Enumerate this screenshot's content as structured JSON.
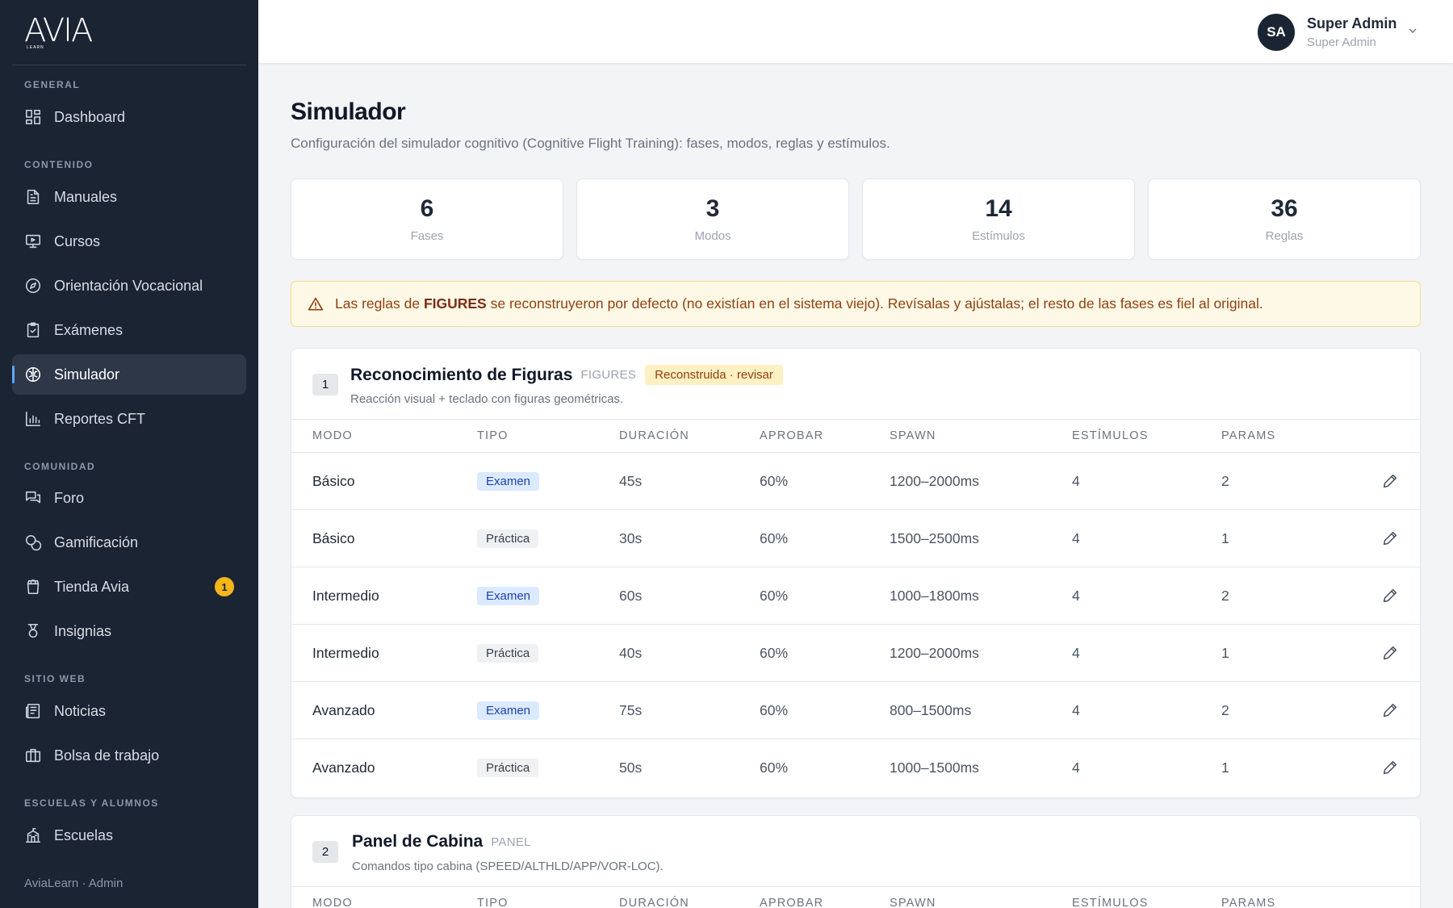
{
  "brand": {
    "logo": "AVIA",
    "logo_sub": "LEARN"
  },
  "sidebar": {
    "sections": [
      {
        "title": "GENERAL"
      },
      {
        "title": "CONTENIDO"
      },
      {
        "title": "COMUNIDAD"
      },
      {
        "title": "SITIO WEB"
      },
      {
        "title": "ESCUELAS Y ALUMNOS"
      }
    ],
    "items": [
      {
        "label": "Dashboard",
        "icon": "dashboard-icon"
      },
      {
        "label": "Manuales",
        "icon": "document-icon"
      },
      {
        "label": "Cursos",
        "icon": "presentation-icon"
      },
      {
        "label": "Orientación Vocacional",
        "icon": "compass-icon"
      },
      {
        "label": "Exámenes",
        "icon": "clipboard-check-icon"
      },
      {
        "label": "Simulador",
        "icon": "brain-icon",
        "active": true
      },
      {
        "label": "Reportes CFT",
        "icon": "bar-chart-icon"
      },
      {
        "label": "Foro",
        "icon": "chat-icon"
      },
      {
        "label": "Gamificación",
        "icon": "coins-icon"
      },
      {
        "label": "Tienda Avia",
        "icon": "shopping-bag-icon",
        "badge": "1"
      },
      {
        "label": "Insignias",
        "icon": "medal-icon"
      },
      {
        "label": "Noticias",
        "icon": "newspaper-icon"
      },
      {
        "label": "Bolsa de trabajo",
        "icon": "briefcase-icon"
      },
      {
        "label": "Escuelas",
        "icon": "school-icon"
      }
    ],
    "footer": "AviaLearn · Admin"
  },
  "user": {
    "initials": "SA",
    "name": "Super Admin",
    "role": "Super Admin"
  },
  "page": {
    "title": "Simulador",
    "subtitle": "Configuración del simulador cognitivo (Cognitive Flight Training): fases, modos, reglas y estímulos."
  },
  "stats": [
    {
      "value": "6",
      "label": "Fases"
    },
    {
      "value": "3",
      "label": "Modos"
    },
    {
      "value": "14",
      "label": "Estímulos"
    },
    {
      "value": "36",
      "label": "Reglas"
    }
  ],
  "alert": {
    "prefix": "Las reglas de ",
    "bold": "FIGURES",
    "suffix": " se reconstruyeron por defecto (no existían en el sistema viejo). Revísalas y ajústalas; el resto de las fases es fiel al original."
  },
  "table_headers": {
    "modo": "MODO",
    "tipo": "TIPO",
    "duracion": "DURACIÓN",
    "aprobar": "APROBAR",
    "spawn": "SPAWN",
    "estimulos": "ESTÍMULOS",
    "params": "PARAMS"
  },
  "phases": [
    {
      "number": "1",
      "title": "Reconocimiento de Figuras",
      "code": "FIGURES",
      "badge": "Reconstruida · revisar",
      "description": "Reacción visual + teclado con figuras geométricas.",
      "rows": [
        {
          "modo": "Básico",
          "tipo": "Examen",
          "duracion": "45s",
          "aprobar": "60%",
          "spawn": "1200–2000ms",
          "estimulos": "4",
          "params": "2"
        },
        {
          "modo": "Básico",
          "tipo": "Práctica",
          "duracion": "30s",
          "aprobar": "60%",
          "spawn": "1500–2500ms",
          "estimulos": "4",
          "params": "1"
        },
        {
          "modo": "Intermedio",
          "tipo": "Examen",
          "duracion": "60s",
          "aprobar": "60%",
          "spawn": "1000–1800ms",
          "estimulos": "4",
          "params": "2"
        },
        {
          "modo": "Intermedio",
          "tipo": "Práctica",
          "duracion": "40s",
          "aprobar": "60%",
          "spawn": "1200–2000ms",
          "estimulos": "4",
          "params": "1"
        },
        {
          "modo": "Avanzado",
          "tipo": "Examen",
          "duracion": "75s",
          "aprobar": "60%",
          "spawn": "800–1500ms",
          "estimulos": "4",
          "params": "2"
        },
        {
          "modo": "Avanzado",
          "tipo": "Práctica",
          "duracion": "50s",
          "aprobar": "60%",
          "spawn": "1000–1500ms",
          "estimulos": "4",
          "params": "1"
        }
      ]
    },
    {
      "number": "2",
      "title": "Panel de Cabina",
      "code": "PANEL",
      "description": "Comandos tipo cabina (SPEED/ALTHLD/APP/VOR-LOC)."
    }
  ]
}
